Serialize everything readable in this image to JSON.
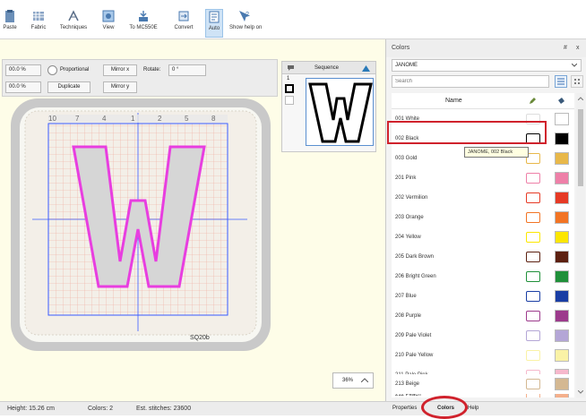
{
  "ribbon": {
    "items": [
      {
        "label": "Paste",
        "icon": "paste-icon"
      },
      {
        "label": "Fabric",
        "icon": "fabric-icon"
      },
      {
        "label": "Techniques",
        "icon": "techniques-icon"
      },
      {
        "label": "View",
        "icon": "view-icon"
      },
      {
        "label": "To MC550E",
        "icon": "send-to-machine-icon"
      },
      {
        "label": "Convert",
        "icon": "convert-icon"
      },
      {
        "label": "Auto",
        "icon": "auto-icon"
      },
      {
        "label": "Show help on",
        "icon": "help-pointer-icon"
      }
    ]
  },
  "toolbar": {
    "scale_x": "00.0 %",
    "scale_y": "00.0 %",
    "proportional_label": "Proportional",
    "mirror_x_label": "Mirror x",
    "rotate_label": "Rotate:",
    "rotate_value": "0 °",
    "duplicate_label": "Duplicate",
    "mirror_y_label": "Mirror y"
  },
  "sequence": {
    "title": "Sequence",
    "item_number": "1",
    "letter": "W"
  },
  "design": {
    "letter": "W",
    "hoop_label": "SQ20b",
    "ruler_ticks": [
      "10",
      "7",
      "4",
      "1",
      "2",
      "5",
      "8"
    ]
  },
  "zoom": {
    "value": "36%"
  },
  "status": {
    "height": "Height: 15.26 cm",
    "colors": "Colors: 2",
    "stitches": "Est. stitches: 23600"
  },
  "colors_panel": {
    "title": "Colors",
    "pin_icon": "#",
    "close_icon": "x",
    "brand": "JANOME",
    "search_placeholder": "Search",
    "column_name": "Name",
    "tooltip": "JANOME, 002 Black",
    "rows": [
      {
        "name": "001 White",
        "color": "#ffffff"
      },
      {
        "name": "002 Black",
        "color": "#000000"
      },
      {
        "name": "003 Gold",
        "color": "#e8b84a"
      },
      {
        "name": "201 Pink",
        "color": "#ee80a8"
      },
      {
        "name": "202 Vermilion",
        "color": "#e63a25"
      },
      {
        "name": "203 Orange",
        "color": "#f27424"
      },
      {
        "name": "204 Yellow",
        "color": "#fce600"
      },
      {
        "name": "205 Dark Brown",
        "color": "#5c2010"
      },
      {
        "name": "206 Bright Green",
        "color": "#20903a"
      },
      {
        "name": "207 Blue",
        "color": "#1a3ea4"
      },
      {
        "name": "208 Purple",
        "color": "#9c3a8c"
      },
      {
        "name": "209 Pale Violet",
        "color": "#b4a6d6"
      },
      {
        "name": "210 Pale Yellow",
        "color": "#faf2a6"
      },
      {
        "name": "211 Pale Pink",
        "color": "#f6b8cc"
      },
      {
        "name": "212 Peach",
        "color": "#f4b08c"
      },
      {
        "name": "213 Beige",
        "color": "#d4b892"
      }
    ]
  },
  "bottom_tabs": {
    "properties": "Properties",
    "colors": "Colors",
    "help": "Help"
  },
  "accent_colors": {
    "highlight": "#d0222c",
    "letter_outline": "#e83ee0",
    "guide": "#3a5bff"
  }
}
